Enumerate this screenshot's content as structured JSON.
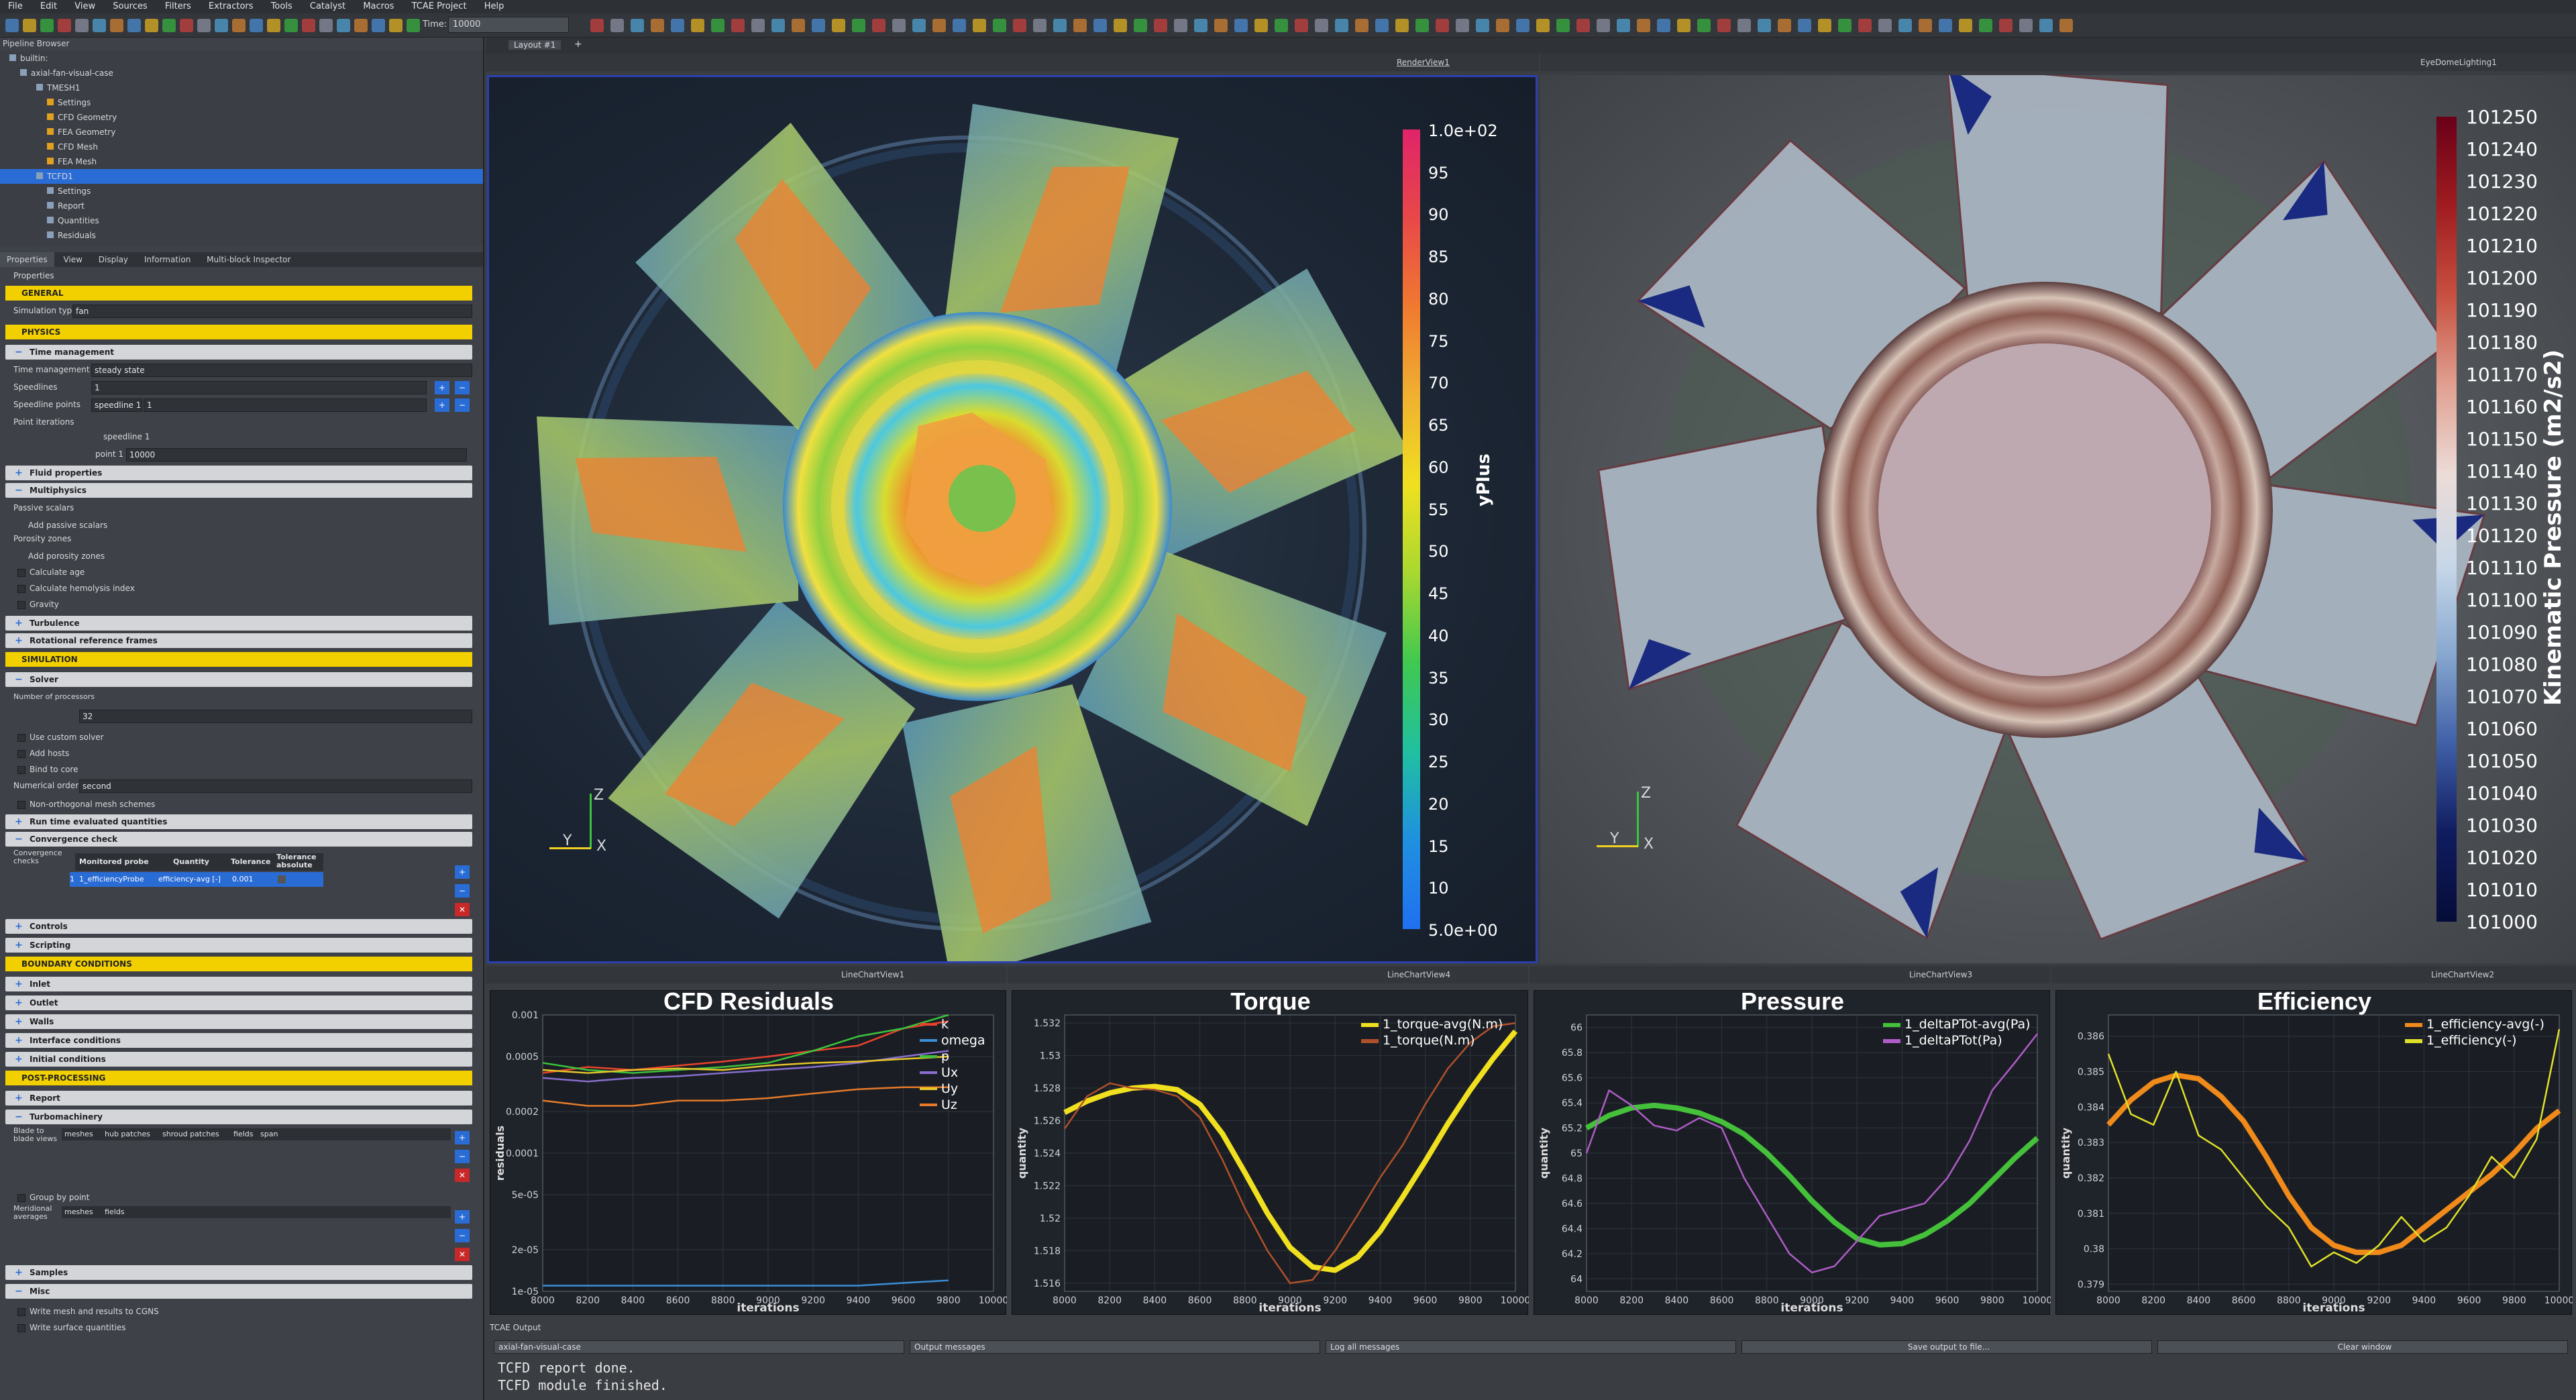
{
  "menu": [
    "File",
    "Edit",
    "View",
    "Sources",
    "Filters",
    "Extractors",
    "Tools",
    "Catalyst",
    "Macros",
    "TCAE Project",
    "Help"
  ],
  "toolbar": {
    "time_label": "Time:",
    "time_value": "10000"
  },
  "pipeline": {
    "title": "Pipeline Browser",
    "items": [
      "builtin:",
      "axial-fan-visual-case",
      "TMESH1",
      "Settings",
      "CFD Geometry",
      "FEA Geometry",
      "CFD Mesh",
      "FEA Mesh",
      "TCFD1",
      "Settings",
      "Report",
      "Quantities",
      "Residuals"
    ]
  },
  "prop_tabs": [
    "Properties",
    "View",
    "Display",
    "Information",
    "Multi-block Inspector"
  ],
  "props": {
    "title": "Properties",
    "general": "GENERAL",
    "simulation_type_label": "Simulation type",
    "simulation_type_value": "fan",
    "physics": "PHYSICS",
    "time_management": "Time management",
    "time_mgmt_label": "Time management",
    "time_mgmt_value": "steady state",
    "speedlines_label": "Speedlines",
    "speedlines_value": "1",
    "speedline_points_label": "Speedline points",
    "speedline_points_a": "speedline 1",
    "speedline_points_b": "1",
    "point_iterations_label": "Point iterations",
    "speedline1": "speedline 1",
    "point1": "point 1",
    "point1_value": "10000",
    "fluid_properties": "Fluid properties",
    "multiphysics": "Multiphysics",
    "passive_scalars": "Passive scalars",
    "add_passive": "Add passive scalars",
    "porosity_zones": "Porosity zones",
    "add_porosity": "Add porosity zones",
    "calc_age": "Calculate age",
    "calc_hemolysis": "Calculate hemolysis index",
    "gravity": "Gravity",
    "turbulence": "Turbulence",
    "rotational": "Rotational reference frames",
    "simulation": "SIMULATION",
    "solver": "Solver",
    "num_proc_label": "Number of processors",
    "num_proc_value": "32",
    "custom_solver": "Use custom solver",
    "add_hosts": "Add hosts",
    "bind_core": "Bind to core",
    "num_order_label": "Numerical order",
    "num_order_value": "second",
    "nonortho": "Non-orthogonal mesh schemes",
    "runtime": "Run time evaluated quantities",
    "convergence": "Convergence check",
    "conv_checks_label": "Convergence checks",
    "conv_cols": [
      "Monitored probe",
      "Quantity",
      "Tolerance",
      "Tolerance absolute"
    ],
    "conv_row": [
      "1",
      "1_efficiencyProbe",
      "efficiency-avg [-]",
      "0.001"
    ],
    "controls": "Controls",
    "scripting": "Scripting",
    "boundary": "BOUNDARY CONDITIONS",
    "inlet": "Inlet",
    "outlet": "Outlet",
    "walls": "Walls",
    "interface": "Interface conditions",
    "initial": "Initial conditions",
    "post": "POST-PROCESSING",
    "report": "Report",
    "turbomachinery": "Turbomachinery",
    "b2b_label": "Blade to blade views",
    "b2b_cols": [
      "meshes",
      "hub patches",
      "shroud patches",
      "fields",
      "span"
    ],
    "group_by_point": "Group by point",
    "meridional_label": "Meridional averages",
    "meridional_cols": [
      "meshes",
      "fields"
    ],
    "samples": "Samples",
    "misc": "Misc",
    "write_cgns": "Write mesh and results to CGNS",
    "write_surface": "Write surface quantities"
  },
  "layout_tab": "Layout #1",
  "views": {
    "left_name": "RenderView1",
    "right_name": "EyeDomeLighting1",
    "chart_names": [
      "LineChartView1",
      "LineChartView4",
      "LineChartView3",
      "LineChartView2"
    ]
  },
  "colorbar_left": {
    "title": "yPlus",
    "labels": [
      "1.0e+02",
      "95",
      "90",
      "85",
      "80",
      "75",
      "70",
      "65",
      "60",
      "55",
      "50",
      "45",
      "40",
      "35",
      "30",
      "25",
      "20",
      "15",
      "10",
      "5.0e+00"
    ]
  },
  "colorbar_right": {
    "title": "Kinematic Pressure (m2/s2)",
    "labels": [
      "101250",
      "101240",
      "101230",
      "101220",
      "101210",
      "101200",
      "101190",
      "101180",
      "101170",
      "101160",
      "101150",
      "101140",
      "101130",
      "101120",
      "101110",
      "101100",
      "101090",
      "101080",
      "101070",
      "101060",
      "101050",
      "101040",
      "101030",
      "101020",
      "101010",
      "101000"
    ]
  },
  "axes_labels": {
    "z": "Z",
    "y": "Y",
    "x": "X"
  },
  "colors": {
    "accent_yellow": "#f2d000",
    "view_border": "#2b3fb0",
    "chart_bg": "#1f232a"
  },
  "chart_data": [
    {
      "type": "line",
      "title": "CFD Residuals",
      "xlabel": "iterations",
      "ylabel": "residuals",
      "xlim": [
        8000,
        10000
      ],
      "log_y": true,
      "xticks": [
        "8000",
        "8200",
        "8400",
        "8600",
        "8800",
        "9000",
        "9200",
        "9400",
        "9600",
        "9800",
        "10000"
      ],
      "yticks": [
        "0.001",
        "0.0005",
        "0.0002",
        "0.0001",
        "5e-05",
        "2e-05",
        "1e-05"
      ],
      "x": [
        8000,
        8200,
        8400,
        8600,
        8800,
        9000,
        9200,
        9400,
        9600,
        9800
      ],
      "series": [
        {
          "name": "k",
          "color": "#e8432d",
          "values": [
            0.00038,
            0.00042,
            0.0004,
            0.00043,
            0.00046,
            0.0005,
            0.00055,
            0.0006,
            0.0008,
            0.0009
          ]
        },
        {
          "name": "omega",
          "color": "#3a8fd6",
          "values": [
            1.1e-05,
            1.1e-05,
            1.1e-05,
            1.1e-05,
            1.1e-05,
            1.1e-05,
            1.1e-05,
            1.1e-05,
            1.15e-05,
            1.2e-05
          ]
        },
        {
          "name": "p",
          "color": "#3cc43c",
          "values": [
            0.00045,
            0.0004,
            0.00038,
            0.0004,
            0.00042,
            0.00045,
            0.00055,
            0.0007,
            0.0008,
            0.001
          ]
        },
        {
          "name": "Ux",
          "color": "#8a6fd1",
          "values": [
            0.00035,
            0.00033,
            0.00035,
            0.00036,
            0.00038,
            0.0004,
            0.00042,
            0.00045,
            0.0005,
            0.00055
          ]
        },
        {
          "name": "Uy",
          "color": "#e7c62a",
          "values": [
            0.0004,
            0.00038,
            0.0004,
            0.00041,
            0.0004,
            0.00043,
            0.00045,
            0.00046,
            0.00048,
            0.0005
          ]
        },
        {
          "name": "Uz",
          "color": "#e47a2a",
          "values": [
            0.00024,
            0.00022,
            0.00022,
            0.00024,
            0.00024,
            0.00025,
            0.00027,
            0.00029,
            0.0003,
            0.0003
          ]
        }
      ]
    },
    {
      "type": "line",
      "title": "Torque",
      "xlabel": "iterations",
      "ylabel": "quantity",
      "xlim": [
        8000,
        10000
      ],
      "ylim": [
        1.5155,
        1.5325
      ],
      "xticks": [
        "8000",
        "8200",
        "8400",
        "8600",
        "8800",
        "9000",
        "9200",
        "9400",
        "9600",
        "9800",
        "10000"
      ],
      "yticks": [
        "1.532",
        "1.53",
        "1.528",
        "1.526",
        "1.524",
        "1.522",
        "1.52",
        "1.518",
        "1.516"
      ],
      "x": [
        8000,
        8100,
        8200,
        8300,
        8400,
        8500,
        8600,
        8700,
        8800,
        8900,
        9000,
        9100,
        9200,
        9300,
        9400,
        9500,
        9600,
        9700,
        9800,
        9900,
        10000
      ],
      "series": [
        {
          "name": "1_torque-avg(N.m)",
          "color": "#f0e020",
          "values": [
            1.5265,
            1.5272,
            1.5277,
            1.528,
            1.5281,
            1.5279,
            1.527,
            1.5252,
            1.5228,
            1.5203,
            1.5182,
            1.517,
            1.5168,
            1.5176,
            1.5192,
            1.5213,
            1.5235,
            1.5258,
            1.5279,
            1.5298,
            1.5315
          ]
        },
        {
          "name": "1_torque(N.m)",
          "color": "#b0502a",
          "values": [
            1.5255,
            1.5275,
            1.5283,
            1.528,
            1.5279,
            1.5275,
            1.5262,
            1.5236,
            1.5206,
            1.518,
            1.516,
            1.5162,
            1.518,
            1.5202,
            1.5225,
            1.5245,
            1.527,
            1.5292,
            1.5308,
            1.5318,
            1.532
          ]
        }
      ]
    },
    {
      "type": "line",
      "title": "Pressure",
      "xlabel": "iterations",
      "ylabel": "quantity",
      "xlim": [
        8000,
        10000
      ],
      "ylim": [
        63.9,
        66.1
      ],
      "xticks": [
        "8000",
        "8200",
        "8400",
        "8600",
        "8800",
        "9000",
        "9200",
        "9400",
        "9600",
        "9800",
        "10000"
      ],
      "yticks": [
        "66",
        "65.8",
        "65.6",
        "65.4",
        "65.2",
        "65",
        "64.8",
        "64.6",
        "64.4",
        "64.2",
        "64"
      ],
      "x": [
        8000,
        8100,
        8200,
        8300,
        8400,
        8500,
        8600,
        8700,
        8800,
        8900,
        9000,
        9100,
        9200,
        9300,
        9400,
        9500,
        9600,
        9700,
        9800,
        9900,
        10000
      ],
      "series": [
        {
          "name": "1_deltaPTot-avg(Pa)",
          "color": "#44c03a",
          "values": [
            65.2,
            65.3,
            65.36,
            65.38,
            65.36,
            65.32,
            65.25,
            65.15,
            65.0,
            64.82,
            64.62,
            64.45,
            64.32,
            64.27,
            64.28,
            64.35,
            64.46,
            64.6,
            64.78,
            64.96,
            65.12
          ]
        },
        {
          "name": "1_deltaPTot(Pa)",
          "color": "#b05cc8",
          "values": [
            65.0,
            65.5,
            65.38,
            65.22,
            65.18,
            65.28,
            65.2,
            64.8,
            64.5,
            64.2,
            64.05,
            64.1,
            64.3,
            64.5,
            64.55,
            64.6,
            64.8,
            65.1,
            65.5,
            65.72,
            65.95
          ]
        }
      ]
    },
    {
      "type": "line",
      "title": "Efficiency",
      "xlabel": "iterations",
      "ylabel": "quantity",
      "xlim": [
        8000,
        10000
      ],
      "ylim": [
        0.3788,
        0.3866
      ],
      "xticks": [
        "8000",
        "8200",
        "8400",
        "8600",
        "8800",
        "9000",
        "9200",
        "9400",
        "9600",
        "9800",
        "10000"
      ],
      "yticks": [
        "0.386",
        "0.385",
        "0.384",
        "0.383",
        "0.382",
        "0.381",
        "0.38",
        "0.379"
      ],
      "x": [
        8000,
        8100,
        8200,
        8300,
        8400,
        8500,
        8600,
        8700,
        8800,
        8900,
        9000,
        9100,
        9200,
        9300,
        9400,
        9500,
        9600,
        9700,
        9800,
        9900,
        10000
      ],
      "series": [
        {
          "name": "1_efficiency-avg(-)",
          "color": "#f08a1a",
          "values": [
            0.3835,
            0.3842,
            0.3847,
            0.3849,
            0.3848,
            0.3843,
            0.3836,
            0.3826,
            0.3815,
            0.3806,
            0.3801,
            0.3799,
            0.3799,
            0.3801,
            0.3806,
            0.3811,
            0.3816,
            0.3821,
            0.3827,
            0.3834,
            0.3839
          ]
        },
        {
          "name": "1_efficiency(-)",
          "color": "#e0e02a",
          "values": [
            0.3855,
            0.3838,
            0.3835,
            0.385,
            0.3832,
            0.3828,
            0.382,
            0.3812,
            0.3806,
            0.3795,
            0.3799,
            0.3796,
            0.3801,
            0.3809,
            0.3802,
            0.3806,
            0.3815,
            0.3826,
            0.382,
            0.3831,
            0.3862
          ]
        }
      ]
    }
  ],
  "output": {
    "title": "TCAE Output",
    "source": "axial-fan-visual-case",
    "filter": "Output messages",
    "log_mode": "Log all messages",
    "save": "Save output to file...",
    "clear": "Clear window",
    "lines": [
      "TCFD report done.",
      "TCFD module finished."
    ]
  }
}
